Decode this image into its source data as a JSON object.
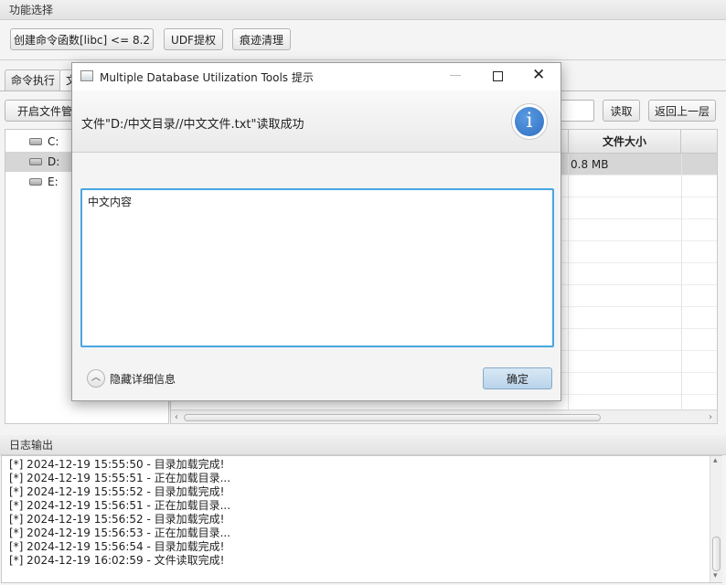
{
  "func_section": {
    "title": "功能选择",
    "buttons": [
      "创建命令函数[libc] <= 8.2",
      "UDF提权",
      "痕迹清理"
    ]
  },
  "tabs": [
    "命令执行",
    "文"
  ],
  "file_toolbar": {
    "open_button": "开启文件管理",
    "read_button": "读取",
    "back_button": "返回上一层"
  },
  "drives": [
    "C:",
    "D:",
    "E:"
  ],
  "table": {
    "size_header": "文件大小",
    "first_row_size": "0.8 MB"
  },
  "log_section": {
    "title": "日志输出",
    "lines": [
      "[*] 2024-12-19 15:55:50 - 目录加载完成!",
      "[*] 2024-12-19 15:55:51 - 正在加载目录...",
      "[*] 2024-12-19 15:55:52 - 目录加载完成!",
      "[*] 2024-12-19 15:56:51 - 正在加载目录...",
      "[*] 2024-12-19 15:56:52 - 目录加载完成!",
      "[*] 2024-12-19 15:56:53 - 正在加载目录...",
      "[*] 2024-12-19 15:56:54 - 目录加载完成!",
      "[*] 2024-12-19 16:02:59 - 文件读取完成!"
    ]
  },
  "dialog": {
    "title": "Multiple Database Utilization Tools 提示",
    "header_text": "文件\"D:/中文目录//中文文件.txt\"读取成功",
    "content": "中文内容",
    "details_toggle": "隐藏详细信息",
    "ok_button": "确定",
    "info_icon_glyph": "i",
    "accent_color": "#2e6fc0"
  }
}
